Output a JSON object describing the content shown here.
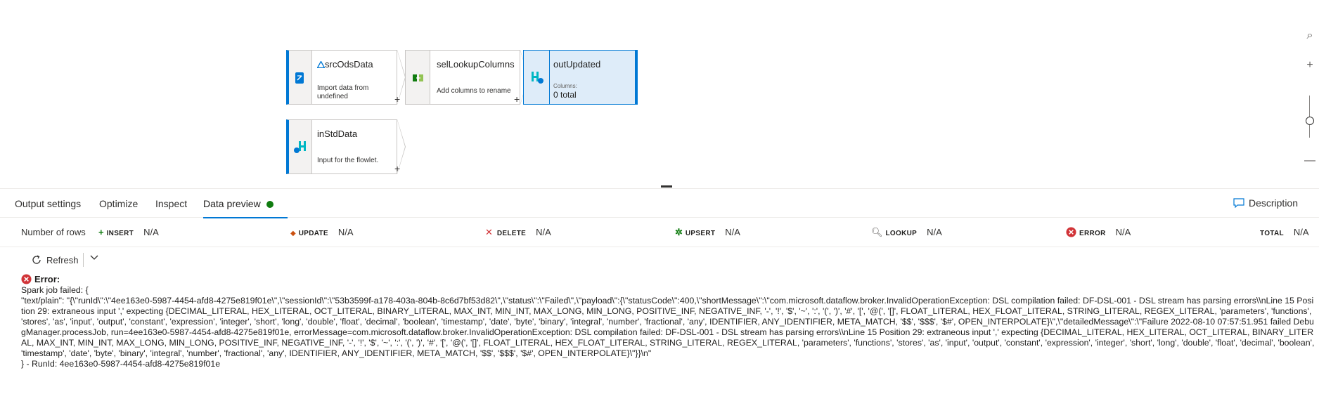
{
  "canvas": {
    "nodes": {
      "src": {
        "title": "srcOdsData",
        "desc": "Import data from undefined"
      },
      "sel": {
        "title": "selLookupColumns",
        "desc": "Add columns to rename"
      },
      "out": {
        "title": "outUpdated",
        "caption": "Columns:",
        "value": "0 total"
      },
      "in": {
        "title": "inStdData",
        "desc": "Input for the flowlet."
      }
    },
    "plus": "+"
  },
  "tabs": [
    {
      "label": "Output settings"
    },
    {
      "label": "Optimize"
    },
    {
      "label": "Inspect"
    },
    {
      "label": "Data preview",
      "status_color": "#107c10"
    }
  ],
  "description_label": "Description",
  "stats": {
    "rows_label": "Number of rows",
    "insert": {
      "label": "INSERT",
      "value": "N/A"
    },
    "update": {
      "label": "UPDATE",
      "value": "N/A"
    },
    "delete": {
      "label": "DELETE",
      "value": "N/A"
    },
    "upsert": {
      "label": "UPSERT",
      "value": "N/A"
    },
    "lookup": {
      "label": "LOOKUP",
      "value": "N/A"
    },
    "error": {
      "label": "ERROR",
      "value": "N/A"
    },
    "total": {
      "label": "TOTAL",
      "value": "N/A"
    }
  },
  "toolbar": {
    "refresh_label": "Refresh"
  },
  "error": {
    "heading": "Error:",
    "line1": "Spark job failed: {",
    "body": "\"text/plain\": \"{\\\"runId\\\":\\\"4ee163e0-5987-4454-afd8-4275e819f01e\\\",\\\"sessionId\\\":\\\"53b3599f-a178-403a-804b-8c6d7bf53d82\\\",\\\"status\\\":\\\"Failed\\\",\\\"payload\\\":{\\\"statusCode\\\":400,\\\"shortMessage\\\":\\\"com.microsoft.dataflow.broker.InvalidOperationException: DSL compilation failed: DF-DSL-001 - DSL stream has parsing errors\\\\nLine 15 Position 29: extraneous input ',' expecting {DECIMAL_LITERAL, HEX_LITERAL, OCT_LITERAL, BINARY_LITERAL, MAX_INT, MIN_INT, MAX_LONG, MIN_LONG, POSITIVE_INF, NEGATIVE_INF, '-', '!', '$', '~', ':', '(', ')', '#', '[', '@(', '[]', FLOAT_LITERAL, HEX_FLOAT_LITERAL, STRING_LITERAL, REGEX_LITERAL, 'parameters', 'functions', 'stores', 'as', 'input', 'output', 'constant', 'expression', 'integer', 'short', 'long', 'double', 'float', 'decimal', 'boolean', 'timestamp', 'date', 'byte', 'binary', 'integral', 'number', 'fractional', 'any', IDENTIFIER, ANY_IDENTIFIER, META_MATCH, '$$', '$$$', '$#', OPEN_INTERPOLATE}\\\",\\\"detailedMessage\\\":\\\"Failure 2022-08-10 07:57:51.951 failed DebugManager.processJob, run=4ee163e0-5987-4454-afd8-4275e819f01e, errorMessage=com.microsoft.dataflow.broker.InvalidOperationException: DSL compilation failed: DF-DSL-001 - DSL stream has parsing errors\\\\nLine 15 Position 29: extraneous input ',' expecting {DECIMAL_LITERAL, HEX_LITERAL, OCT_LITERAL, BINARY_LITERAL, MAX_INT, MIN_INT, MAX_LONG, MIN_LONG, POSITIVE_INF, NEGATIVE_INF, '-', '!', '$', '~', ':', '(', ')', '#', '[', '@(', '[]', FLOAT_LITERAL, HEX_FLOAT_LITERAL, STRING_LITERAL, REGEX_LITERAL, 'parameters', 'functions', 'stores', 'as', 'input', 'output', 'constant', 'expression', 'integer', 'short', 'long', 'double', 'float', 'decimal', 'boolean', 'timestamp', 'date', 'byte', 'binary', 'integral', 'number', 'fractional', 'any', IDENTIFIER, ANY_IDENTIFIER, META_MATCH, '$$', '$$$', '$#', OPEN_INTERPOLATE}\\\"}}\\n\"",
    "footer": "} - RunId: 4ee163e0-5987-4454-afd8-4275e819f01e"
  },
  "colors": {
    "accent": "#0078d4",
    "success": "#107c10",
    "error": "#d13438",
    "selected_fill": "#deecf9"
  }
}
